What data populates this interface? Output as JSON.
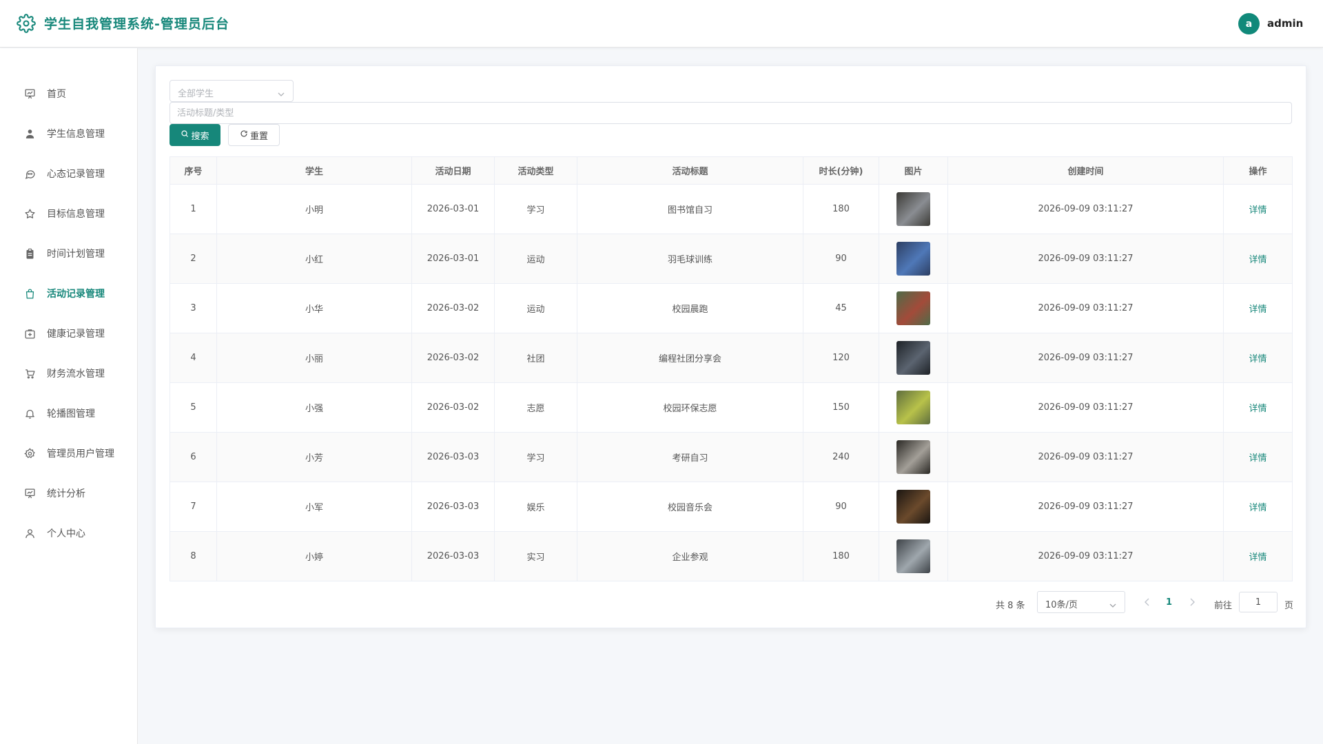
{
  "header": {
    "title": "学生自我管理系统-管理员后台",
    "avatar_letter": "a",
    "username": "admin"
  },
  "sidebar": {
    "items": [
      {
        "label": "首页",
        "icon": "chart-board-icon"
      },
      {
        "label": "学生信息管理",
        "icon": "user-icon"
      },
      {
        "label": "心态记录管理",
        "icon": "chat-icon"
      },
      {
        "label": "目标信息管理",
        "icon": "star-icon"
      },
      {
        "label": "时间计划管理",
        "icon": "clipboard-icon"
      },
      {
        "label": "活动记录管理",
        "icon": "shopping-bag-icon",
        "active": true
      },
      {
        "label": "健康记录管理",
        "icon": "first-aid-icon"
      },
      {
        "label": "财务流水管理",
        "icon": "cart-icon"
      },
      {
        "label": "轮播图管理",
        "icon": "bell-icon"
      },
      {
        "label": "管理员用户管理",
        "icon": "gear-icon"
      },
      {
        "label": "统计分析",
        "icon": "chart-board-icon"
      },
      {
        "label": "个人中心",
        "icon": "user-outline-icon"
      }
    ]
  },
  "filters": {
    "student_select_placeholder": "全部学生",
    "keyword_placeholder": "活动标题/类型",
    "search_label": "搜索",
    "reset_label": "重置"
  },
  "table": {
    "columns": [
      "序号",
      "学生",
      "活动日期",
      "活动类型",
      "活动标题",
      "时长(分钟)",
      "图片",
      "创建时间",
      "操作"
    ],
    "action_label": "详情",
    "rows": [
      {
        "index": "1",
        "student": "小明",
        "date": "2026-03-01",
        "type": "学习",
        "title": "图书馆自习",
        "duration": "180",
        "created": "2026-09-09 03:11:27",
        "thumb_colors": [
          "#3b3a36",
          "#8a8d92"
        ]
      },
      {
        "index": "2",
        "student": "小红",
        "date": "2026-03-01",
        "type": "运动",
        "title": "羽毛球训练",
        "duration": "90",
        "created": "2026-09-09 03:11:27",
        "thumb_colors": [
          "#2d3f63",
          "#4f78b8"
        ]
      },
      {
        "index": "3",
        "student": "小华",
        "date": "2026-03-02",
        "type": "运动",
        "title": "校园晨跑",
        "duration": "45",
        "created": "2026-09-09 03:11:27",
        "thumb_colors": [
          "#4f6b48",
          "#a34b3a"
        ]
      },
      {
        "index": "4",
        "student": "小丽",
        "date": "2026-03-02",
        "type": "社团",
        "title": "编程社团分享会",
        "duration": "120",
        "created": "2026-09-09 03:11:27",
        "thumb_colors": [
          "#1e2227",
          "#5b6470"
        ]
      },
      {
        "index": "5",
        "student": "小强",
        "date": "2026-03-02",
        "type": "志愿",
        "title": "校园环保志愿",
        "duration": "150",
        "created": "2026-09-09 03:11:27",
        "thumb_colors": [
          "#5f6e3e",
          "#b8c24a"
        ]
      },
      {
        "index": "6",
        "student": "小芳",
        "date": "2026-03-03",
        "type": "学习",
        "title": "考研自习",
        "duration": "240",
        "created": "2026-09-09 03:11:27",
        "thumb_colors": [
          "#2a2824",
          "#a39f98"
        ]
      },
      {
        "index": "7",
        "student": "小军",
        "date": "2026-03-03",
        "type": "娱乐",
        "title": "校园音乐会",
        "duration": "90",
        "created": "2026-09-09 03:11:27",
        "thumb_colors": [
          "#1b1612",
          "#6b4a2c"
        ]
      },
      {
        "index": "8",
        "student": "小婷",
        "date": "2026-03-03",
        "type": "实习",
        "title": "企业参观",
        "duration": "180",
        "created": "2026-09-09 03:11:27",
        "thumb_colors": [
          "#3e4348",
          "#9fa7ad"
        ]
      }
    ]
  },
  "pagination": {
    "total_text": "共 8 条",
    "page_size": "10条/页",
    "current_page": "1",
    "goto_label": "前往",
    "goto_value": "1",
    "page_suffix": "页"
  },
  "colors": {
    "accent": "#16877a",
    "background": "#f5f7fa"
  }
}
